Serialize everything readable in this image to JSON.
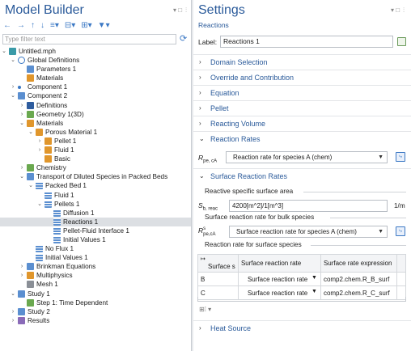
{
  "model_builder": {
    "title": "Model Builder",
    "filter_placeholder": "Type filter text",
    "tree": [
      {
        "label": "Untitled.mph",
        "depth": 0,
        "tw": "v",
        "icon": "c-teal",
        "name": "tree-item-untitled"
      },
      {
        "label": "Global Definitions",
        "depth": 1,
        "tw": "v",
        "icon": "c-globe",
        "name": "tree-item-global-definitions"
      },
      {
        "label": "Parameters 1",
        "depth": 2,
        "tw": "",
        "icon": "c-blue",
        "name": "tree-item-parameters-1",
        "glyph": "P₁"
      },
      {
        "label": "Materials",
        "depth": 2,
        "tw": "",
        "icon": "c-orange",
        "name": "tree-item-materials-global"
      },
      {
        "label": "Component 1",
        "depth": 1,
        "tw": ">",
        "icon": "c-dot",
        "name": "tree-item-component-1"
      },
      {
        "label": "Component 2",
        "depth": 1,
        "tw": "v",
        "icon": "c-blue",
        "name": "tree-item-component-2"
      },
      {
        "label": "Definitions",
        "depth": 2,
        "tw": ">",
        "icon": "c-navy",
        "name": "tree-item-definitions"
      },
      {
        "label": "Geometry 1(3D)",
        "depth": 2,
        "tw": ">",
        "icon": "c-green",
        "name": "tree-item-geometry-1"
      },
      {
        "label": "Materials",
        "depth": 2,
        "tw": "v",
        "icon": "c-orange",
        "name": "tree-item-materials"
      },
      {
        "label": "Porous Material 1",
        "depth": 3,
        "tw": "v",
        "icon": "c-orange",
        "name": "tree-item-porous-material-1"
      },
      {
        "label": "Pellet 1",
        "depth": 4,
        "tw": ">",
        "icon": "c-orange",
        "name": "tree-item-pellet-1"
      },
      {
        "label": "Fluid 1",
        "depth": 4,
        "tw": ">",
        "icon": "c-orange",
        "name": "tree-item-fluid-1-mat"
      },
      {
        "label": "Basic",
        "depth": 4,
        "tw": "",
        "icon": "c-orange",
        "name": "tree-item-basic"
      },
      {
        "label": "Chemistry",
        "depth": 2,
        "tw": ">",
        "icon": "c-green",
        "name": "tree-item-chemistry"
      },
      {
        "label": "Transport of Diluted Species in Packed Beds",
        "depth": 2,
        "tw": "v",
        "icon": "c-blue",
        "name": "tree-item-transport"
      },
      {
        "label": "Packed Bed 1",
        "depth": 3,
        "tw": "v",
        "icon": "c-stripes",
        "name": "tree-item-packed-bed-1"
      },
      {
        "label": "Fluid 1",
        "depth": 4,
        "tw": "",
        "icon": "c-stripes",
        "name": "tree-item-fluid-1"
      },
      {
        "label": "Pellets 1",
        "depth": 4,
        "tw": "v",
        "icon": "c-stripes",
        "name": "tree-item-pellets-1"
      },
      {
        "label": "Diffusion 1",
        "depth": 5,
        "tw": "",
        "icon": "c-stripes",
        "name": "tree-item-diffusion-1"
      },
      {
        "label": "Reactions 1",
        "depth": 5,
        "tw": "",
        "icon": "c-stripes",
        "name": "tree-item-reactions-1",
        "selected": true
      },
      {
        "label": "Pellet-Fluid Interface 1",
        "depth": 5,
        "tw": "",
        "icon": "c-stripes",
        "name": "tree-item-pellet-fluid-interface-1"
      },
      {
        "label": "Initial Values 1",
        "depth": 5,
        "tw": "",
        "icon": "c-stripes",
        "name": "tree-item-initial-values-1-pellet"
      },
      {
        "label": "No Flux 1",
        "depth": 3,
        "tw": "",
        "icon": "c-stripes",
        "name": "tree-item-no-flux-1"
      },
      {
        "label": "Initial Values 1",
        "depth": 3,
        "tw": "",
        "icon": "c-stripes",
        "name": "tree-item-initial-values-1"
      },
      {
        "label": "Brinkman Equations",
        "depth": 2,
        "tw": ">",
        "icon": "c-blue",
        "name": "tree-item-brinkman-equations"
      },
      {
        "label": "Multiphysics",
        "depth": 2,
        "tw": ">",
        "icon": "c-orange",
        "name": "tree-item-multiphysics"
      },
      {
        "label": "Mesh 1",
        "depth": 2,
        "tw": "",
        "icon": "c-gray",
        "name": "tree-item-mesh-1"
      },
      {
        "label": "Study 1",
        "depth": 1,
        "tw": "v",
        "icon": "c-blue",
        "name": "tree-item-study-1"
      },
      {
        "label": "Step 1: Time Dependent",
        "depth": 2,
        "tw": "",
        "icon": "c-green",
        "name": "tree-item-step-1"
      },
      {
        "label": "Study 2",
        "depth": 1,
        "tw": ">",
        "icon": "c-blue",
        "name": "tree-item-study-2"
      },
      {
        "label": "Results",
        "depth": 1,
        "tw": ">",
        "icon": "c-purple",
        "name": "tree-item-results"
      }
    ]
  },
  "settings": {
    "title": "Settings",
    "subtitle": "Reactions",
    "label_caption": "Label:",
    "label_value": "Reactions 1",
    "sections": {
      "domain_selection": "Domain Selection",
      "override": "Override and Contribution",
      "equation": "Equation",
      "pellet": "Pellet",
      "reacting_volume": "Reacting Volume",
      "reaction_rates": "Reaction Rates",
      "surface_reaction_rates": "Surface Reaction Rates",
      "heat_source": "Heat Source"
    },
    "reaction_rate": {
      "symbol": "R",
      "symbol_sub": "pe, cA",
      "value": "Reaction rate for species A (chem)"
    },
    "surface": {
      "area_label": "Reactive specific surface area",
      "area_symbol": "S",
      "area_sub": "b, reac",
      "area_value": "4200[m^2]/1[m^3]",
      "area_unit": "1/m",
      "bulk_label": "Surface reaction rate for bulk species",
      "bulk_symbol": "R",
      "bulk_sup": "s",
      "bulk_sub": "pe,cA",
      "bulk_value": "Surface reaction rate for species A (chem)",
      "surf_label": "Reaction rate for surface species",
      "table": {
        "headers": [
          "Surface s",
          "Surface reaction rate",
          "Surface rate expression"
        ],
        "header_glyph": "↦",
        "rows": [
          {
            "species": "B",
            "rate": "Surface reaction rate",
            "expr": "comp2.chem.R_B_surf"
          },
          {
            "species": "C",
            "rate": "Surface reaction rate",
            "expr": "comp2.chem.R_C_surf"
          }
        ]
      }
    }
  }
}
